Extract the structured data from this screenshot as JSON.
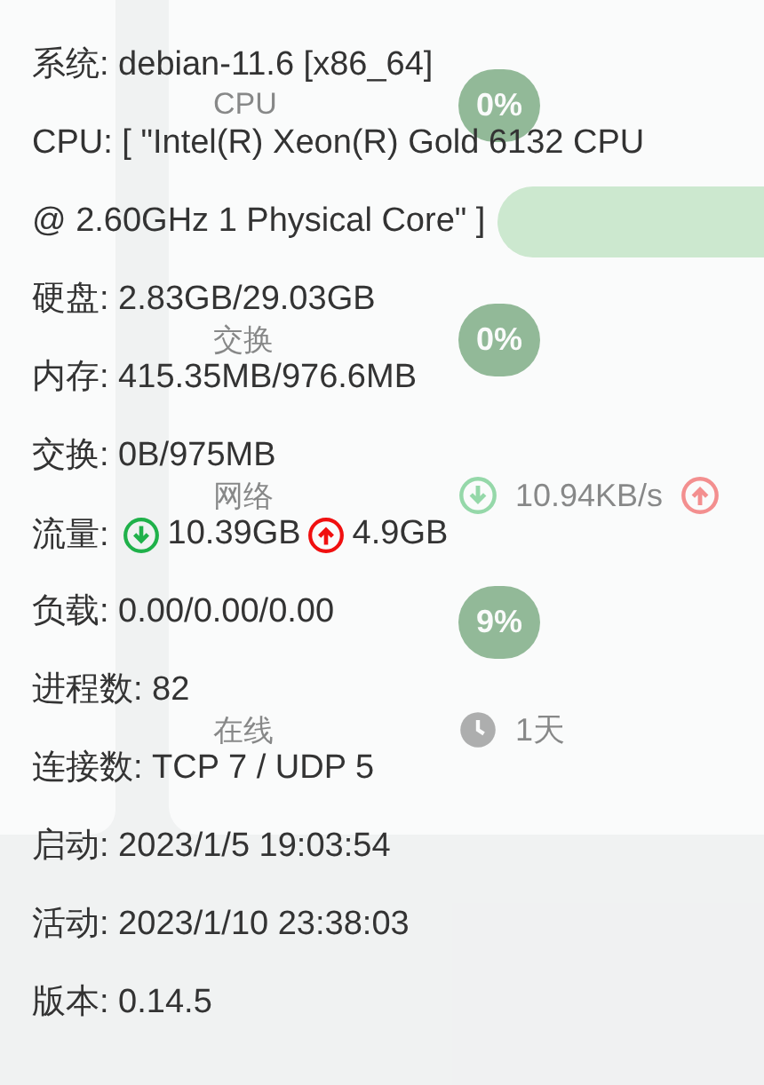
{
  "background_card": {
    "rows": [
      {
        "kind": "pill",
        "label": "CPU",
        "value": "0%"
      },
      {
        "kind": "bar"
      },
      {
        "kind": "pill",
        "label": "交换",
        "value": "0%"
      },
      {
        "kind": "network",
        "label": "网络",
        "value": "10.94KB/s"
      },
      {
        "kind": "pill",
        "value": "9%"
      },
      {
        "kind": "uptime",
        "label": "在线",
        "value": "1天"
      }
    ]
  },
  "tooltip": {
    "lines": [
      {
        "kind": "text",
        "text": "系统: debian-11.6 [x86_64]"
      },
      {
        "kind": "text",
        "text": "CPU: [ \"Intel(R) Xeon(R) Gold 6132 CPU @ 2.60GHz 1 Physical Core\" ]"
      },
      {
        "kind": "text",
        "text": "硬盘: 2.83GB/29.03GB"
      },
      {
        "kind": "text",
        "text": "内存: 415.35MB/976.6MB"
      },
      {
        "kind": "text",
        "text": "交换: 0B/975MB"
      },
      {
        "kind": "traffic",
        "label": "流量:",
        "down": "10.39GB",
        "up": "4.9GB"
      },
      {
        "kind": "text",
        "text": "负载: 0.00/0.00/0.00"
      },
      {
        "kind": "text",
        "text": "进程数: 82"
      },
      {
        "kind": "text",
        "text": "连接数: TCP 7 / UDP 5"
      },
      {
        "kind": "text",
        "text": "启动: 2023/1/5 19:03:54"
      },
      {
        "kind": "text",
        "text": "活动: 2023/1/10 23:38:03"
      },
      {
        "kind": "text",
        "text": "版本: 0.14.5"
      }
    ]
  }
}
